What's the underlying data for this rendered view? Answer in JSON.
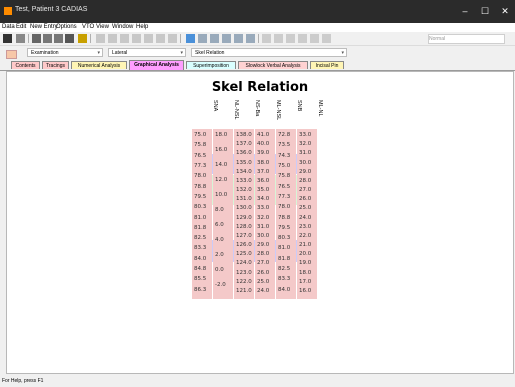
{
  "window": {
    "title": "Test, Patient 3 CADIAS"
  },
  "menu": [
    "Data",
    "Edit",
    "New Entry",
    "Options",
    "VTO",
    "View",
    "Window",
    "Help"
  ],
  "toolbar": {
    "normal_placeholder": "Normal"
  },
  "combos": {
    "examination": "Examination",
    "lateral": "Lateral",
    "analysis": "Skel Relation"
  },
  "tabs": [
    {
      "label": "Contents",
      "color": "#ffc9c9"
    },
    {
      "label": "Tracings",
      "color": "#ffc9c9"
    },
    {
      "label": "Numerical Analysis",
      "color": "#fff5b5"
    },
    {
      "label": "Graphical Analysis",
      "color": "#ff9eff",
      "active": true
    },
    {
      "label": "Superimposition",
      "color": "#d9ffff"
    },
    {
      "label": "Slowlock Verbal Analysis",
      "color": "#ffd2d2"
    },
    {
      "label": "Incisal Pin",
      "color": "#fff5b5"
    }
  ],
  "status": "For Help, press F1",
  "chart_data": {
    "type": "table",
    "title": "Skel Relation",
    "columns": [
      {
        "name": "SNA",
        "values": [
          "75.0",
          "75.8",
          "76.5",
          "77.3",
          "78.0",
          "78.8",
          "79.5",
          "80.3",
          "81.0",
          "81.8",
          "82.5",
          "83.3",
          "84.0",
          "84.8",
          "85.5",
          "86.3"
        ]
      },
      {
        "name": "NL-NSL",
        "values": [
          "18.0",
          "16.0",
          "14.0",
          "12.0",
          "10.0",
          "8.0",
          "6.0",
          "4.0",
          "2.0",
          "0.0",
          "-2.0"
        ]
      },
      {
        "name": "NS-Ba",
        "values": [
          "138.0",
          "137.0",
          "136.0",
          "135.0",
          "134.0",
          "133.0",
          "132.0",
          "131.0",
          "130.0",
          "129.0",
          "128.0",
          "127.0",
          "126.0",
          "125.0",
          "124.0",
          "123.0",
          "122.0",
          "121.0"
        ]
      },
      {
        "name": "ML-NSL",
        "values": [
          "41.0",
          "40.0",
          "39.0",
          "38.0",
          "37.0",
          "36.0",
          "35.0",
          "34.0",
          "33.0",
          "32.0",
          "31.0",
          "30.0",
          "29.0",
          "28.0",
          "27.0",
          "26.0",
          "25.0",
          "24.0"
        ]
      },
      {
        "name": "SNB",
        "values": [
          "72.8",
          "73.5",
          "74.3",
          "75.0",
          "75.8",
          "76.5",
          "77.3",
          "78.0",
          "78.8",
          "79.5",
          "80.3",
          "81.0",
          "81.8",
          "82.5",
          "83.3",
          "84.0"
        ]
      },
      {
        "name": "ML-NL",
        "values": [
          "33.0",
          "32.0",
          "31.0",
          "30.0",
          "29.0",
          "28.0",
          "27.0",
          "26.0",
          "25.0",
          "24.0",
          "23.0",
          "22.0",
          "21.0",
          "20.0",
          "19.0",
          "18.0",
          "17.0",
          "16.0"
        ]
      }
    ]
  },
  "colors": {
    "pink": "#f4c9c9",
    "blue": "#b9b9f5",
    "green": "#c9f2c9"
  }
}
